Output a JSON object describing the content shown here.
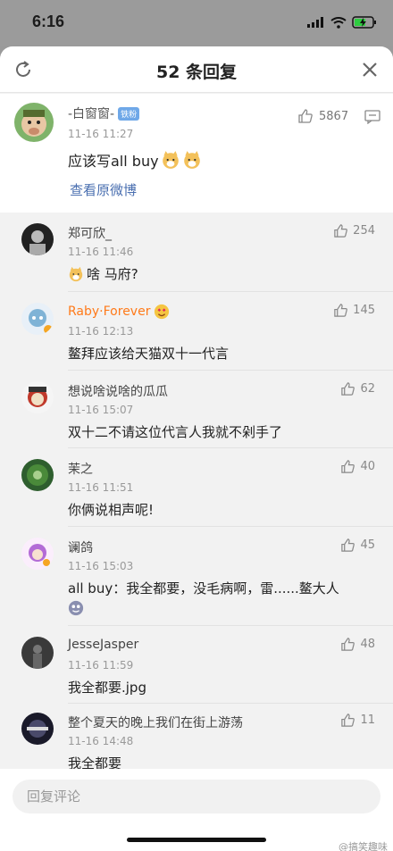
{
  "status": {
    "time": "6:16"
  },
  "header": {
    "title": "52 条回复"
  },
  "main_comment": {
    "user": "-白窗窗-",
    "badge": "铁粉",
    "time": "11-16 11:27",
    "text": "应该写all buy",
    "likes": "5867",
    "link": "查看原微博"
  },
  "replies": [
    {
      "user": "郑可欣_",
      "time": "11-16 11:46",
      "text": "啥 马府?",
      "likes": "254"
    },
    {
      "user": "Raby·Forever",
      "time": "11-16 12:13",
      "text": "鳌拜应该给天猫双十一代言",
      "likes": "145"
    },
    {
      "user": "想说啥说啥的瓜瓜",
      "time": "11-16 15:07",
      "text": "双十二不请这位代言人我就不剁手了",
      "likes": "62"
    },
    {
      "user": "茉之",
      "time": "11-16 11:51",
      "text": "你俩说相声呢!",
      "likes": "40"
    },
    {
      "user": "谰鸽",
      "time": "11-16 15:03",
      "text": "all buy：我全都要，没毛病啊，雷......鳌大人",
      "likes": "45"
    },
    {
      "user": "JesseJasper",
      "time": "11-16 11:59",
      "text": "我全都要.jpg",
      "likes": "48"
    },
    {
      "user": "整个夏天的晚上我们在街上游荡",
      "time": "11-16 14:48",
      "text": "我全都要",
      "likes": "11"
    }
  ],
  "input": {
    "placeholder": "回复评论"
  },
  "watermark": "@搞笑趣味",
  "colors": {
    "link": "#4a6fb0",
    "orange_name": "#ff7a1a",
    "badge": "#6fa8e8"
  }
}
